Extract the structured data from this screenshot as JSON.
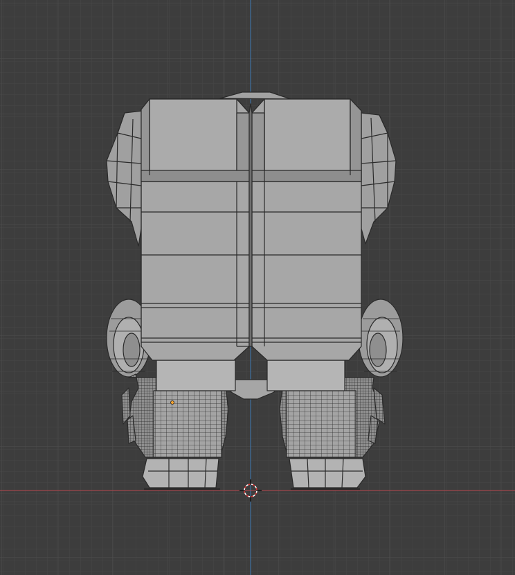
{
  "viewport": {
    "colors": {
      "background": "#3d3d3d",
      "grid_minor": "#454545",
      "grid_major": "#4f4f4f",
      "axis_x": "#b8464f",
      "axis_z": "#3f79b4",
      "mesh_fill": "#a8a8a8",
      "mesh_fill_dark": "#8e8e8e",
      "mesh_fill_light": "#b3b3b3",
      "wire": "#2a2a2a",
      "origin_dot": "#f0a030"
    },
    "icons": {
      "cursor": "3d-cursor-icon",
      "origin": "object-origin-icon"
    }
  }
}
